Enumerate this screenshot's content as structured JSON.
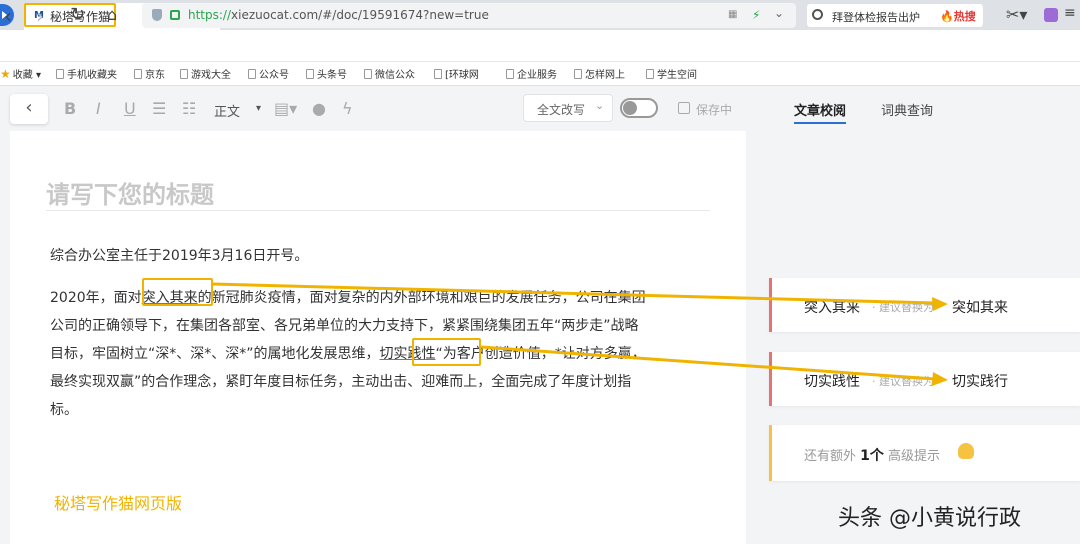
{
  "browser": {
    "tab_title": "秘塔写作猫",
    "tab_logo": "M",
    "url_scheme": "https://",
    "url_rest": "xiezuocat.com/#/doc/19591674?new=true",
    "search_text": "拜登体检报告出炉",
    "hot_label": "热搜"
  },
  "bookmarks": [
    "收藏",
    "手机收藏夹",
    "京东",
    "游戏大全",
    "公众号",
    "头条号",
    "微信公众",
    "[环球网",
    "企业服务",
    "怎样网上",
    "学生空间"
  ],
  "toolbar": {
    "back": "‹",
    "bold": "B",
    "italic": "I",
    "underline": "U",
    "ul": "☰",
    "ol": "☷",
    "heading": "正文",
    "rewrite_label": "全文改写",
    "save_status": "保存中"
  },
  "document": {
    "title_placeholder": "请写下您的标题",
    "paragraph1": "综合办公室主任于2019年3月16日开号。",
    "line1_a": "2020年，面对",
    "line1_mark": "突入其来",
    "line1_b": "的新冠肺炎疫情，面对复杂的内外部环境和艰巨的发展任务，公司在集团",
    "line2": "公司的正确领导下，在集团各部室、各兄弟单位的大力支持下，紧紧围绕集团五年“两步走”战略",
    "line3_a": "目标，牢固树立“深*、深*、深*”的属地化发展思维，",
    "line3_mark": "切实践性",
    "line3_b": "“为客户创造价值，*让对方多赢，",
    "line4": "最终实现双赢”的合作理念，紧盯年度目标任务，主动出击、迎难而上，全面完成了年度计划指",
    "line5": "标。",
    "watermark": "秘塔写作猫网页版"
  },
  "panel": {
    "tab_active": "文章校阅",
    "tab_other": "词典查询",
    "suggestions": [
      {
        "original": "突入其来",
        "hint": "· 建议替换为",
        "suggestion": "突如其来"
      },
      {
        "original": "切实践性",
        "hint": "· 建议替换为",
        "suggestion": "切实践行"
      }
    ],
    "extra_prefix": "还有额外",
    "extra_count": "1个",
    "extra_suffix": "高级提示"
  },
  "overlay_watermark": "头条 @小黄说行政",
  "colors": {
    "highlight": "#f0b400",
    "error_border": "#e57373",
    "tip_border": "#f5c242",
    "accent": "#2b6fd6"
  }
}
